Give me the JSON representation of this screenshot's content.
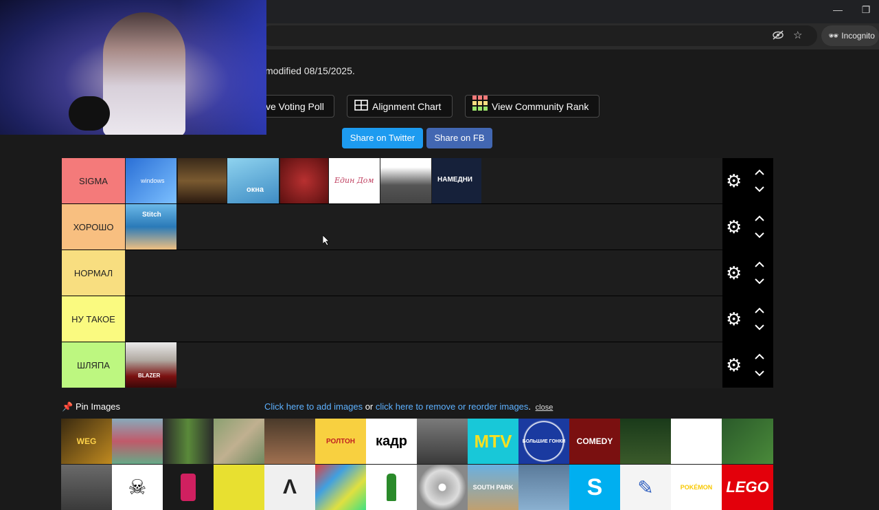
{
  "browser": {
    "incognito_label": "Incognito",
    "minimize": "—",
    "restore": "❐"
  },
  "page": {
    "modified_text": "modified 08/15/2025."
  },
  "buttons": {
    "voting_poll": "ve Voting Poll",
    "alignment_chart": "Alignment Chart",
    "community_rank": "View Community Rank",
    "share_twitter": "Share on Twitter",
    "share_fb": "Share on FB"
  },
  "tiers": [
    {
      "label": "SIGMA",
      "color": "#f47a7a"
    },
    {
      "label": "ХОРОШО",
      "color": "#f8bf80"
    },
    {
      "label": "НОРМАЛ",
      "color": "#f8de80"
    },
    {
      "label": "НУ ТАКОЕ",
      "color": "#fafa80"
    },
    {
      "label": "ШЛЯПА",
      "color": "#bdf780"
    }
  ],
  "tier_items": {
    "sigma": [
      "windows",
      "",
      "окна",
      "",
      "Един Дом",
      "",
      "НАМЕДНИ"
    ],
    "khorosho": [
      "Stitch"
    ],
    "shlyapa": [
      "BLAZER"
    ]
  },
  "pin_bar": {
    "pin_label": "Pin Images",
    "add_link": "Click here to add images",
    "or_text": " or ",
    "remove_link": "click here to remove or reorder images",
    "period": ".",
    "close_link": "close"
  },
  "pool_labels": [
    "WEG",
    "",
    "",
    "",
    "",
    "РОЛТОН",
    "кадр",
    "",
    "MTV",
    "БОЛЬШИЕ ГОНКИ",
    "COMEDY",
    "",
    "",
    "",
    "",
    "☠",
    "",
    "",
    "",
    "",
    "",
    "",
    "SOUTH PARK",
    "",
    "S",
    "",
    "POKÉMON",
    "LEGO"
  ]
}
